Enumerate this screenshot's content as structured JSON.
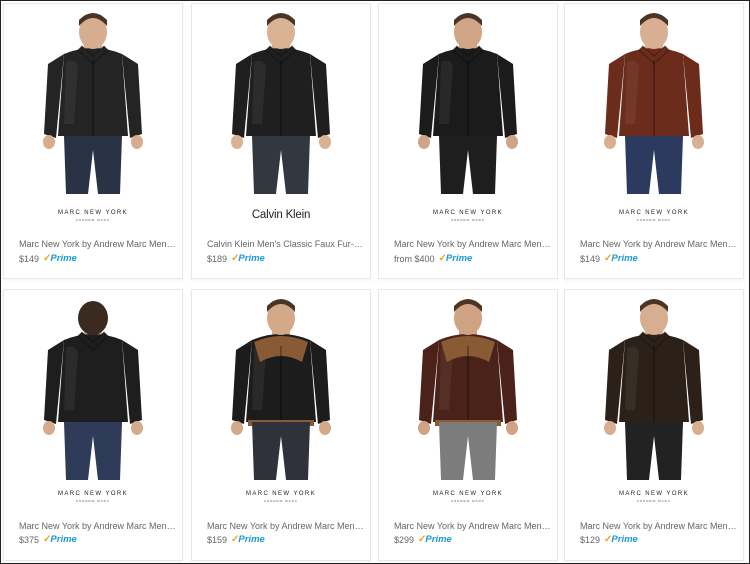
{
  "products": [
    {
      "brand": "MARC NEW YORK",
      "brand_sub": "ANDREW MARC",
      "title": "Marc New York by Andrew Marc Men's B...",
      "price": "$149",
      "prime": "Prime",
      "colors": {
        "jacket": "#242424",
        "pants": "#2a3346",
        "skin": "#d6ad8e"
      }
    },
    {
      "brand": "Calvin Klein",
      "brand_sub": "",
      "title": "Calvin Klein Men's Classic Faux Fur-Lin...",
      "price": "$189",
      "prime": "Prime",
      "colors": {
        "jacket": "#1f1f1f",
        "pants": "#33373f",
        "skin": "#d9b193"
      }
    },
    {
      "brand": "MARC NEW YORK",
      "brand_sub": "ANDREW MARC",
      "title": "Marc New York by Andrew Marc Men's S...",
      "price": "from $400",
      "prime": "Prime",
      "colors": {
        "jacket": "#1b1b1b",
        "pants": "#1e1e1e",
        "skin": "#cfa487"
      }
    },
    {
      "brand": "MARC NEW YORK",
      "brand_sub": "ANDREW MARC",
      "title": "Marc New York by Andrew Marc Men's B...",
      "price": "$149",
      "prime": "Prime",
      "colors": {
        "jacket": "#6b2c1c",
        "pants": "#2b3a5e",
        "skin": "#d8af90"
      }
    },
    {
      "brand": "MARC NEW YORK",
      "brand_sub": "ANDREW MARC",
      "title": "Marc New York by Andrew Marc Men's ...",
      "price": "$375",
      "prime": "Prime",
      "colors": {
        "jacket": "#1e1e1e",
        "pants": "#2e3c5a",
        "skin": "#d5ab8c"
      }
    },
    {
      "brand": "MARC NEW YORK",
      "brand_sub": "ANDREW MARC",
      "title": "Marc New York by Andrew Marc Men's K...",
      "price": "$159",
      "prime": "Prime",
      "colors": {
        "jacket": "#1c1c1c",
        "pants": "#2f323a",
        "skin": "#d3a98a"
      }
    },
    {
      "brand": "MARC NEW YORK",
      "brand_sub": "ANDREW MARC",
      "title": "Marc New York by Andrew Marc Men's P...",
      "price": "$299",
      "prime": "Prime",
      "colors": {
        "jacket": "#4a2219",
        "pants": "#7c7c7c",
        "skin": "#d0a385"
      }
    },
    {
      "brand": "MARC NEW YORK",
      "brand_sub": "ANDREW MARC",
      "title": "Marc New York by Andrew Marc Men's L...",
      "price": "$129",
      "prime": "Prime",
      "colors": {
        "jacket": "#2b2119",
        "pants": "#222222",
        "skin": "#d7ae8f"
      }
    }
  ]
}
